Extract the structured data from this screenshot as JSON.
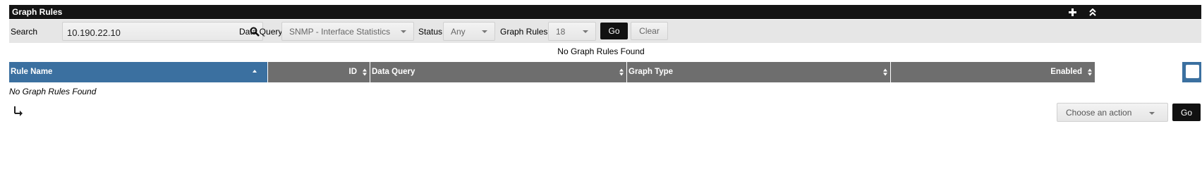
{
  "header": {
    "title": "Graph Rules",
    "add_icon": "plus-icon",
    "collapse_icon": "chevron-double-up-icon"
  },
  "filter": {
    "search_label": "Search",
    "search_value": "10.190.22.10",
    "search_icon": "search-icon",
    "data_query_label": "Data Query",
    "data_query_value": "SNMP - Interface Statistics",
    "status_label": "Status",
    "status_value": "Any",
    "rules_label": "Graph Rules",
    "rules_value": "18",
    "go_label": "Go",
    "clear_label": "Clear"
  },
  "no_results_message": "No Graph Rules Found",
  "table": {
    "columns": [
      {
        "label": "Rule Name",
        "sort": "asc"
      },
      {
        "label": "ID",
        "sort": "both"
      },
      {
        "label": "Data Query",
        "sort": "both"
      },
      {
        "label": "Graph Type",
        "sort": "both"
      },
      {
        "label": "Enabled",
        "sort": "both"
      }
    ],
    "empty_text": "No Graph Rules Found"
  },
  "actions": {
    "select_placeholder": "Choose an action",
    "go_label": "Go",
    "return_icon": "return-arrow-icon"
  },
  "colors": {
    "header_bg": "#141414",
    "active_col": "#3b70a0",
    "col_bg": "#6e6e6e",
    "filter_bg": "#e6e6e6"
  }
}
